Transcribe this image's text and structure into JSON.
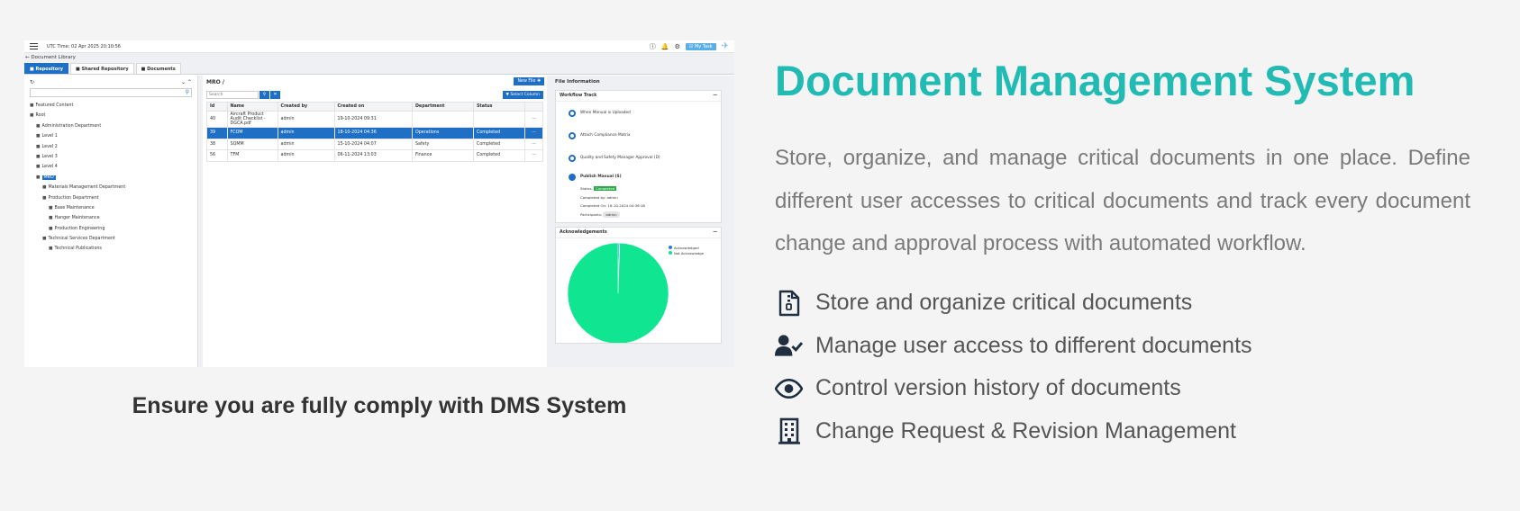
{
  "app": {
    "utc_time": "UTC Time: 02 Apr 2025 20:10:56",
    "my_task": "My Task",
    "library_title": "Document Library",
    "tabs": [
      "Repository",
      "Shared Repository",
      "Documents"
    ]
  },
  "tree": {
    "items": [
      {
        "label": "Featured Content",
        "depth": 0
      },
      {
        "label": "Root",
        "depth": 0
      },
      {
        "label": "Administration Department",
        "depth": 1
      },
      {
        "label": "Level 1",
        "depth": 1
      },
      {
        "label": "Level 2",
        "depth": 1
      },
      {
        "label": "Level 3",
        "depth": 1
      },
      {
        "label": "Level 4",
        "depth": 1
      },
      {
        "label": "MRO",
        "depth": 1,
        "highlight": true
      },
      {
        "label": "Materials Management Department",
        "depth": 2
      },
      {
        "label": "Production Department",
        "depth": 2
      },
      {
        "label": "Base Maintenance",
        "depth": 3
      },
      {
        "label": "Hanger Maintenance",
        "depth": 3
      },
      {
        "label": "Production Engineering",
        "depth": 3
      },
      {
        "label": "Technical Services Department",
        "depth": 2
      },
      {
        "label": "Technical Publications",
        "depth": 3
      }
    ]
  },
  "center": {
    "breadcrumb": "MRO /",
    "new_file": "New File",
    "search_placeholder": "Search",
    "select_column": "Select Column",
    "columns": [
      "Id",
      "Name",
      "Created by",
      "Created on",
      "Department",
      "Status"
    ],
    "rows": [
      [
        "40",
        "Aircraft Product Audit Checklist - DGCA.pdf",
        "admin",
        "19-10-2024 09:31",
        "",
        ""
      ],
      [
        "39",
        "FCOM",
        "admin",
        "18-10-2024 04:36",
        "Operations",
        "Completed"
      ],
      [
        "38",
        "SQMM",
        "admin",
        "15-10-2024 04:07",
        "Safety",
        "Completed"
      ],
      [
        "56",
        "TFM",
        "admin",
        "06-11-2024 13:03",
        "Finance",
        "Completed"
      ]
    ],
    "row_menu": "···"
  },
  "info": {
    "title": "File Information",
    "workflow_title": "Workflow Track",
    "steps": [
      "When Manual is Uploaded",
      "Attach Compliance Matrix",
      "Quality and Safety Manager Approval (D)",
      "Publish Manual (S)"
    ],
    "status_label": "Status:",
    "status_value": "Completed",
    "completed_by": "Completed by: admin",
    "completed_on": "Completed On: 18-10-2024 04:38:18",
    "participants_label": "Participants:",
    "participant": "admin",
    "ack_title": "Acknowledgements",
    "legend": [
      "Acknowledged",
      "Not Acknowledge"
    ]
  },
  "chart_data": {
    "type": "pie",
    "categories": [
      "Acknowledged",
      "Not Acknowledge"
    ],
    "values": [
      0.5,
      99.5
    ],
    "colors": [
      "#2b7bd8",
      "#10e592"
    ],
    "legend_position": "top-right"
  },
  "caption": "Ensure you are fully comply with DMS System",
  "hero": {
    "title": "Document Management System",
    "description": "Store, organize, and manage critical documents in one place. Define different user accesses to critical documents and track every document change and approval process with automated workflow."
  },
  "features": [
    {
      "icon": "document-zip-icon",
      "label": "Store and organize critical documents"
    },
    {
      "icon": "user-check-icon",
      "label": "Manage user access to different documents"
    },
    {
      "icon": "eye-icon",
      "label": "Control version history of documents"
    },
    {
      "icon": "building-icon",
      "label": "Change Request & Revision Management"
    }
  ],
  "colors": {
    "accent": "#22bbb4",
    "primary_ui": "#1f6fc4",
    "icon": "#1f2f3f"
  }
}
